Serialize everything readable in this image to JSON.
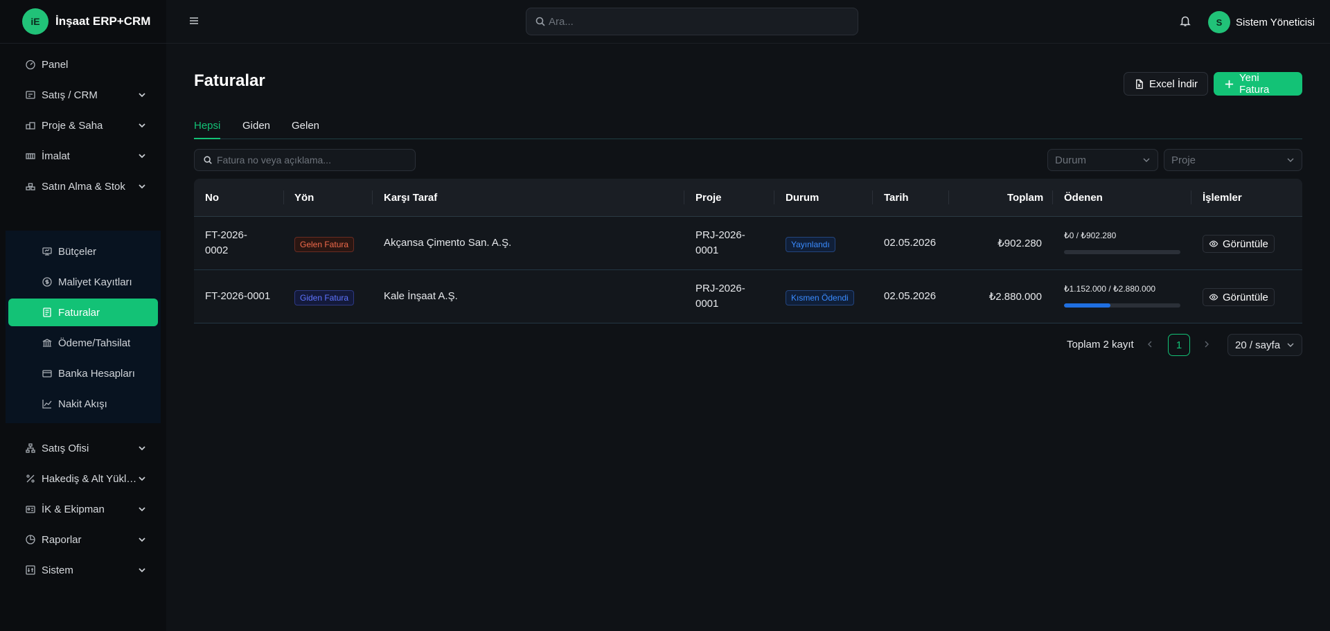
{
  "brand": {
    "logo": "iE",
    "name": "İnşaat ERP+CRM"
  },
  "topbar": {
    "search_placeholder": "Ara...",
    "user_initial": "S",
    "user_name": "Sistem Yöneticisi"
  },
  "sidebar": {
    "items_top": [
      {
        "label": "Panel",
        "icon": "dashboard-icon",
        "chevron": false
      },
      {
        "label": "Satış / CRM",
        "icon": "cash-register-icon",
        "chevron": true
      },
      {
        "label": "Proje & Saha",
        "icon": "buildings-icon",
        "chevron": true
      },
      {
        "label": "İmalat",
        "icon": "factory-icon",
        "chevron": true
      },
      {
        "label": "Satın Alma & Stok",
        "icon": "warehouse-icon",
        "chevron": true
      }
    ],
    "submenu": [
      {
        "label": "Bütçeler",
        "icon": "budget-icon",
        "active": false
      },
      {
        "label": "Maliyet Kayıtları",
        "icon": "coin-icon",
        "active": false
      },
      {
        "label": "Faturalar",
        "icon": "invoice-icon",
        "active": true
      },
      {
        "label": "Ödeme/Tahsilat",
        "icon": "bank-icon",
        "active": false
      },
      {
        "label": "Banka Hesapları",
        "icon": "card-icon",
        "active": false
      },
      {
        "label": "Nakit Akışı",
        "icon": "line-chart-icon",
        "active": false
      }
    ],
    "items_bottom": [
      {
        "label": "Satış Ofisi",
        "icon": "org-chart-icon",
        "chevron": true
      },
      {
        "label": "Hakediş & Alt Yüklenici",
        "icon": "percent-icon",
        "chevron": true
      },
      {
        "label": "İK & Ekipman",
        "icon": "id-card-icon",
        "chevron": true
      },
      {
        "label": "Raporlar",
        "icon": "pie-chart-icon",
        "chevron": true
      },
      {
        "label": "Sistem",
        "icon": "settings-panel-icon",
        "chevron": true
      }
    ]
  },
  "page": {
    "title": "Faturalar",
    "excel_label": "Excel İndir",
    "new_label": "Yeni Fatura"
  },
  "tabs": [
    "Hepsi",
    "Giden",
    "Gelen"
  ],
  "active_tab": "Hepsi",
  "filters": {
    "search_placeholder": "Fatura no veya açıklama...",
    "status_placeholder": "Durum",
    "project_placeholder": "Proje"
  },
  "table": {
    "columns": [
      "No",
      "Yön",
      "Karşı Taraf",
      "Proje",
      "Durum",
      "Tarih",
      "Toplam",
      "Ödenen",
      "İşlemler"
    ],
    "rows": [
      {
        "no": "FT-2026-0002",
        "direction": "Gelen Fatura",
        "party": "Akçansa Çimento San. A.Ş.",
        "project": "PRJ-2026-0001",
        "status": "Yayınlandı",
        "date": "02.05.2026",
        "total": "₺902.280",
        "paid": "₺0 / ₺902.280",
        "paid_ratio": 0,
        "action": "Görüntüle"
      },
      {
        "no": "FT-2026-0001",
        "direction": "Giden Fatura",
        "party": "Kale İnşaat A.Ş.",
        "project": "PRJ-2026-0001",
        "status": "Kısmen Ödendi",
        "date": "02.05.2026",
        "total": "₺2.880.000",
        "paid": "₺1.152.000 / ₺2.880.000",
        "paid_ratio": 0.4,
        "action": "Görüntüle"
      }
    ]
  },
  "pagination": {
    "total_text": "Toplam 2 kayıt",
    "current_page": "1",
    "page_size": "20 / sayfa"
  },
  "colors": {
    "accent": "#13c276",
    "background": "#0f1216",
    "sidebar": "#0b0d10",
    "progress": "#1f6fe0"
  }
}
